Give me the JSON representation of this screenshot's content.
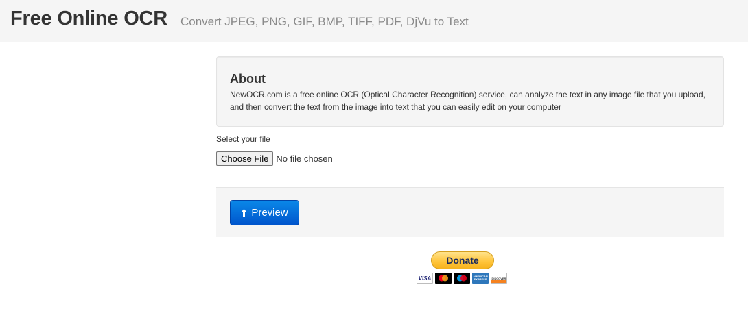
{
  "header": {
    "title": "Free Online OCR",
    "subtitle": "Convert JPEG, PNG, GIF, BMP, TIFF, PDF, DjVu to Text"
  },
  "about": {
    "heading": "About",
    "text": "NewOCR.com is a free online OCR (Optical Character Recognition) service, can analyze the text in any image file that you upload, and then convert the text from the image into text that you can easily edit on your computer"
  },
  "upload": {
    "label": "Select your file",
    "choose_button": "Choose File",
    "status": "No file chosen"
  },
  "actions": {
    "preview_label": "Preview",
    "preview_icon": "arrow-up-icon"
  },
  "donate": {
    "label": "Donate",
    "cards": [
      {
        "name": "visa-card-icon",
        "text": "VISA"
      },
      {
        "name": "mastercard-icon",
        "text": ""
      },
      {
        "name": "maestro-icon",
        "text": ""
      },
      {
        "name": "amex-card-icon",
        "text": "AMERICAN EXPRESS"
      },
      {
        "name": "discover-card-icon",
        "text": "DISCOVER"
      }
    ]
  },
  "colors": {
    "primary_button": "#0055cc",
    "donate_button": "#ffc439",
    "header_bg": "#f5f5f5"
  }
}
